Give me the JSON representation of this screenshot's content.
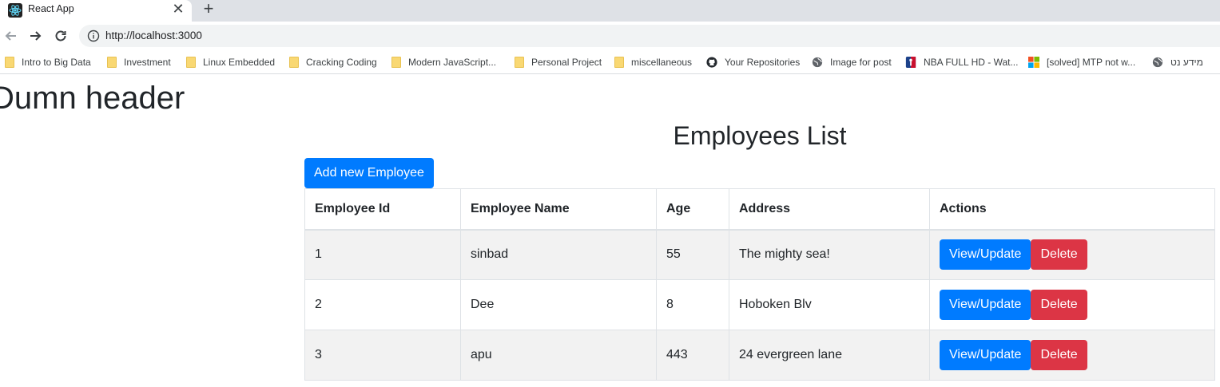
{
  "browser": {
    "tab_title": "React App",
    "tab_close": "✕",
    "new_tab": "+",
    "url": "http://localhost:3000",
    "bookmarks": [
      {
        "label": "Intro to Big Data",
        "icon": "folder-icon"
      },
      {
        "label": "Investment",
        "icon": "folder-icon"
      },
      {
        "label": "Linux Embedded",
        "icon": "folder-icon"
      },
      {
        "label": "Cracking Coding",
        "icon": "folder-icon"
      },
      {
        "label": "Modern JavaScript...",
        "icon": "folder-icon"
      },
      {
        "label": "Personal Project",
        "icon": "folder-icon"
      },
      {
        "label": "miscellaneous",
        "icon": "folder-icon"
      },
      {
        "label": "Your Repositories",
        "icon": "github-icon"
      },
      {
        "label": "Image for post",
        "icon": "globe-icon"
      },
      {
        "label": "NBA FULL HD - Wat...",
        "icon": "nba-icon"
      },
      {
        "label": "[solved] MTP not w...",
        "icon": "microsoft-icon"
      },
      {
        "label": "מידע נט",
        "icon": "globe-icon"
      }
    ]
  },
  "page": {
    "header": "Dumn header",
    "list_title": "Employees List",
    "add_button": "Add new Employee",
    "columns": [
      "Employee Id",
      "Employee Name",
      "Age",
      "Address",
      "Actions"
    ],
    "rows": [
      {
        "id": "1",
        "name": "sinbad",
        "age": "55",
        "address": "The mighty sea!"
      },
      {
        "id": "2",
        "name": "Dee",
        "age": "8",
        "address": "Hoboken Blv"
      },
      {
        "id": "3",
        "name": "apu",
        "age": "443",
        "address": "24 evergreen lane"
      }
    ],
    "view_label": "View/Update",
    "delete_label": "Delete"
  },
  "colors": {
    "primary": "#007bff",
    "danger": "#dc3545",
    "stripe": "#f2f2f2"
  }
}
